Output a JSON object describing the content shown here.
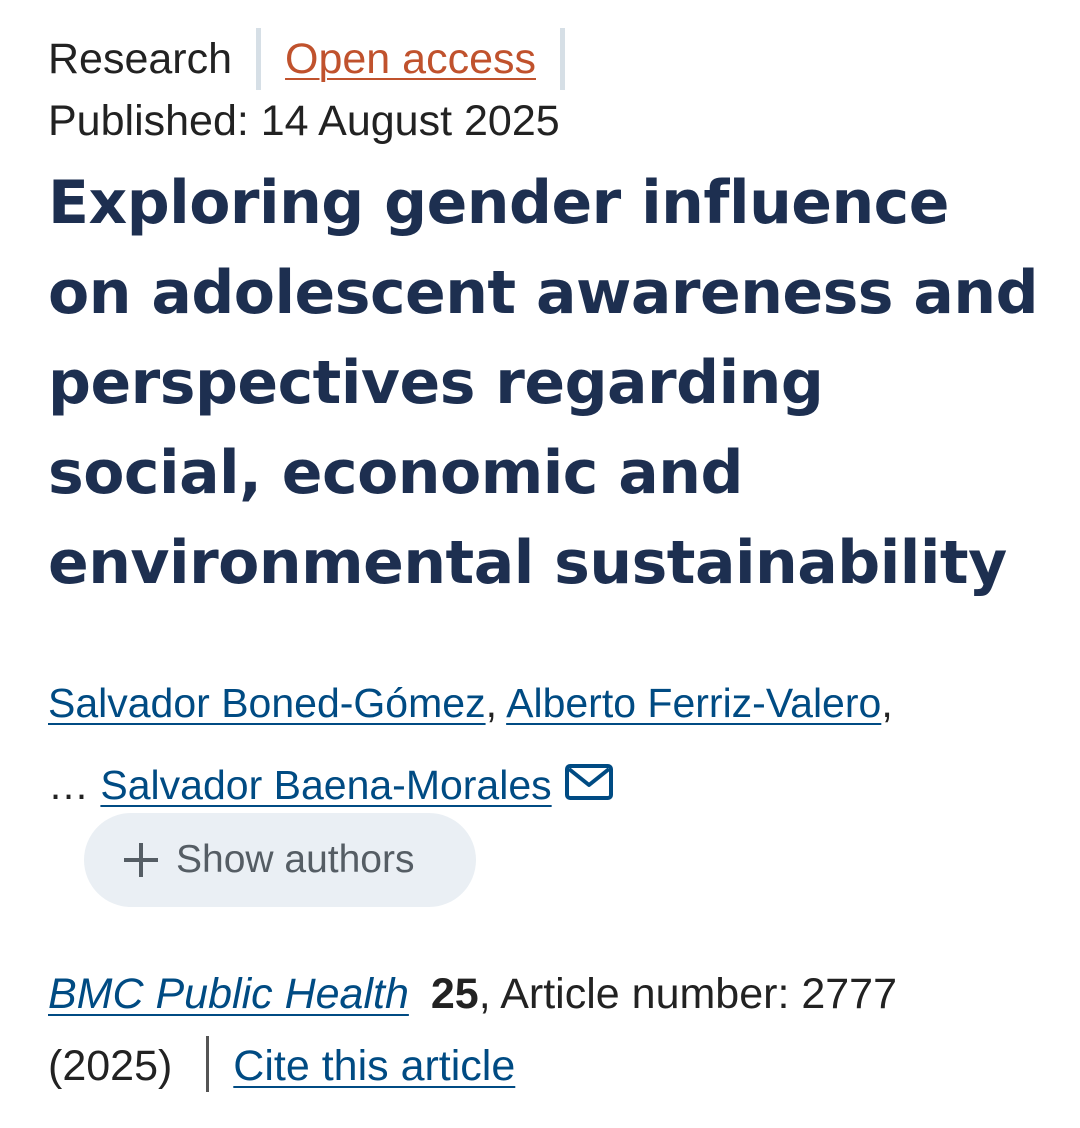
{
  "header": {
    "article_type": "Research",
    "access": "Open access",
    "published_label": "Published:",
    "published_date": "14 August 2025"
  },
  "article": {
    "title": "Exploring gender influence on adolescent awareness and perspectives regarding social, economic and environmental sustainability"
  },
  "authors": {
    "items": [
      {
        "name": "Salvador Boned-Gómez",
        "suffix": ","
      },
      {
        "name": "Alberto Ferriz-Valero",
        "suffix": ","
      },
      {
        "name": "Salvador Baena-Morales",
        "suffix": ""
      }
    ],
    "ellipsis": "…",
    "corresponding_icon": "mail-icon",
    "show_authors_label": "Show authors",
    "show_authors_icon": "plus-icon"
  },
  "citation": {
    "journal": "BMC Public Health",
    "volume": "25",
    "article_number_label": ", Article number: 2777",
    "year": "(2025)",
    "cite_label": "Cite this article"
  },
  "colors": {
    "title": "#1d2f50",
    "link": "#004b83",
    "open_access": "#c0522d",
    "pill_bg": "#eaeff4"
  }
}
